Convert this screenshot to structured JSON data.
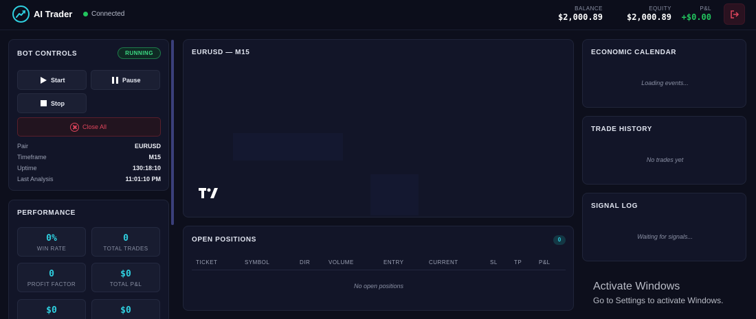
{
  "app": {
    "title": "AI Trader",
    "connection_status": "Connected"
  },
  "header": {
    "balance_label": "BALANCE",
    "balance_value": "$2,000.89",
    "equity_label": "EQUITY",
    "equity_value": "$2,000.89",
    "pnl_label": "P&L",
    "pnl_value": "+$0.00",
    "logout_icon": "logout-icon"
  },
  "bot_controls": {
    "title": "BOT CONTROLS",
    "status": "RUNNING",
    "start_label": "Start",
    "pause_label": "Pause",
    "stop_label": "Stop",
    "close_all_label": "Close All",
    "info": [
      {
        "key": "Pair",
        "value": "EURUSD"
      },
      {
        "key": "Timeframe",
        "value": "M15"
      },
      {
        "key": "Uptime",
        "value": "130:18:10"
      },
      {
        "key": "Last Analysis",
        "value": "11:01:10 PM"
      }
    ]
  },
  "performance": {
    "title": "PERFORMANCE",
    "metrics": [
      {
        "value": "0%",
        "label": "WIN RATE"
      },
      {
        "value": "0",
        "label": "TOTAL TRADES"
      },
      {
        "value": "0",
        "label": "PROFIT FACTOR"
      },
      {
        "value": "$0",
        "label": "TOTAL P&L"
      },
      {
        "value": "$0",
        "label": ""
      },
      {
        "value": "$0",
        "label": ""
      }
    ]
  },
  "chart": {
    "title": "EURUSD — M15",
    "logo_text": "TV"
  },
  "open_positions": {
    "title": "OPEN POSITIONS",
    "count": "0",
    "columns": [
      "TICKET",
      "SYMBOL",
      "DIR",
      "VOLUME",
      "ENTRY",
      "CURRENT",
      "SL",
      "TP",
      "P&L"
    ],
    "empty_text": "No open positions"
  },
  "economic_calendar": {
    "title": "ECONOMIC CALENDAR",
    "empty_text": "Loading events..."
  },
  "trade_history": {
    "title": "TRADE HISTORY",
    "empty_text": "No trades yet"
  },
  "signal_log": {
    "title": "SIGNAL LOG",
    "empty_text": "Waiting for signals..."
  },
  "os_watermark": {
    "title": "Activate Windows",
    "subtitle": "Go to Settings to activate Windows."
  },
  "colors": {
    "accent": "#2fd0e0",
    "positive": "#22c55e",
    "danger": "#e0455c",
    "background": "#0d0f1c"
  }
}
